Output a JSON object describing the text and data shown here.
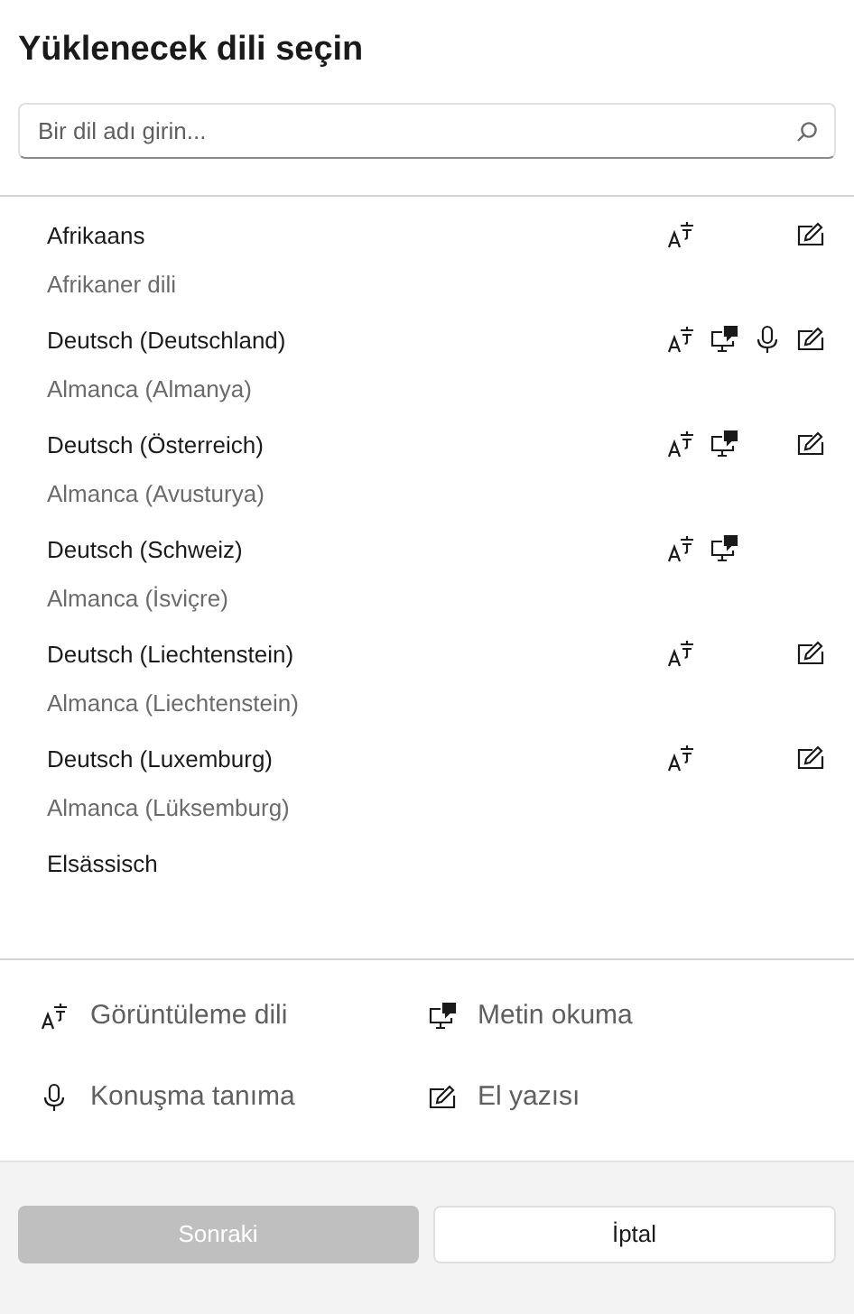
{
  "title": "Yüklenecek dili seçin",
  "search": {
    "placeholder": "Bir dil adı girin..."
  },
  "languages": [
    {
      "name": "Afrikaans",
      "translation": "Afrikaner dili",
      "features": {
        "display": true,
        "tts": false,
        "speech": false,
        "handwriting": true
      }
    },
    {
      "name": "Deutsch (Deutschland)",
      "translation": "Almanca (Almanya)",
      "features": {
        "display": true,
        "tts": true,
        "speech": true,
        "handwriting": true
      }
    },
    {
      "name": "Deutsch (Österreich)",
      "translation": "Almanca (Avusturya)",
      "features": {
        "display": true,
        "tts": true,
        "speech": false,
        "handwriting": true
      }
    },
    {
      "name": "Deutsch (Schweiz)",
      "translation": "Almanca (İsviçre)",
      "features": {
        "display": true,
        "tts": true,
        "speech": false,
        "handwriting": false
      }
    },
    {
      "name": "Deutsch (Liechtenstein)",
      "translation": "Almanca (Liechtenstein)",
      "features": {
        "display": true,
        "tts": false,
        "speech": false,
        "handwriting": true
      }
    },
    {
      "name": "Deutsch (Luxemburg)",
      "translation": "Almanca (Lüksemburg)",
      "features": {
        "display": true,
        "tts": false,
        "speech": false,
        "handwriting": true
      }
    },
    {
      "name": "Elsässisch"
    }
  ],
  "legend": [
    {
      "kind": "display",
      "label": "Görüntüleme dili"
    },
    {
      "kind": "tts",
      "label": "Metin okuma"
    },
    {
      "kind": "speech",
      "label": "Konuşma tanıma"
    },
    {
      "kind": "handwriting",
      "label": "El yazısı"
    }
  ],
  "buttons": [
    {
      "label": "Sonraki",
      "disabled": true
    },
    {
      "label": "İptal",
      "disabled": false
    }
  ]
}
